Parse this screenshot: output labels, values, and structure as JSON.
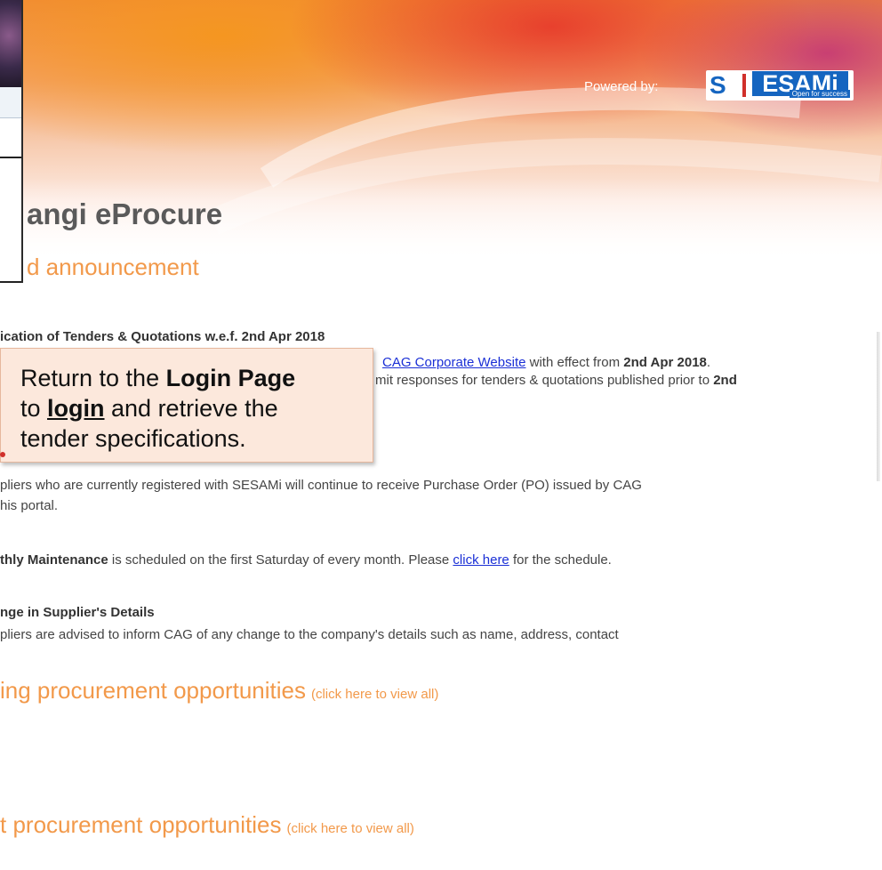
{
  "banner": {
    "powered_by": "Powered by:",
    "logo_left": "S",
    "logo_right": "ESAMi",
    "logo_tagline": "Open for success"
  },
  "page_title": "angi eProcure",
  "announcement_heading": "d announcement",
  "announcements": [
    {
      "title": "ication of Tenders & Quotations w.e.f. 2nd Apr 2018"
    },
    {
      "line1_link": "CAG Corporate Website",
      "line1_mid": " with effect from ",
      "line1_bold": "2nd Apr 2018",
      "line1_end": ".",
      "line2_text": "mit responses for tenders & quotations published prior to ",
      "line2_bold": "2nd"
    },
    {
      "line1": "pliers who are currently registered with SESAMi will continue to receive Purchase Order (PO) issued by CAG",
      "line2": "his portal."
    },
    {
      "bold": "thly Maintenance",
      "text": " is scheduled on the first Saturday of every month. Please ",
      "link": "click here",
      "end": " for the schedule."
    },
    {
      "title": "nge in Supplier's Details",
      "text": "pliers are advised to inform CAG of any change to the company's details such as name, address, contact"
    }
  ],
  "callout": {
    "l1_pre": "Return to the ",
    "l1_bold": "Login Page",
    "l2_pre": "to ",
    "l2_link": "login",
    "l2_post": " and retrieve the",
    "l3": "tender specifications."
  },
  "opportunities": [
    {
      "heading": "ing procurement opportunities",
      "sub": "(click here to view all)"
    },
    {
      "heading": "t procurement opportunities",
      "sub": "(click here to view all)"
    }
  ]
}
